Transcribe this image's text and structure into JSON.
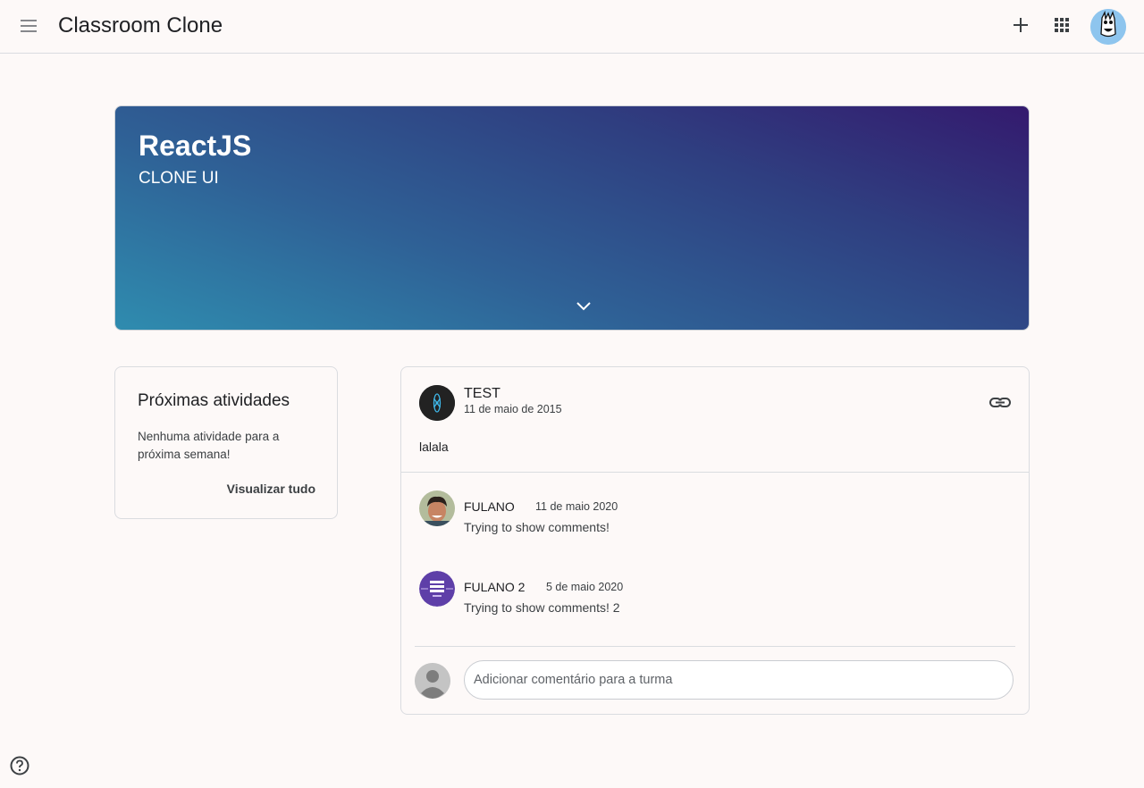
{
  "header": {
    "title": "Classroom Clone",
    "icons": [
      "menu-icon",
      "add-icon",
      "apps-icon",
      "user-avatar"
    ]
  },
  "banner": {
    "name": "ReactJS",
    "section": "CLONE UI",
    "colors": [
      "#2f8caf",
      "#2f6196",
      "#341a6e"
    ],
    "expand_icon": "chevron-down-icon"
  },
  "upcoming": {
    "title": "Próximas atividades",
    "empty_text": "Nenhuma atividade para a próxima semana!",
    "view_all": "Visualizar tudo"
  },
  "post": {
    "author": "TEST",
    "date": "11 de maio de 2015",
    "body": "lalala",
    "link_icon": "link-icon",
    "comments": [
      {
        "author": "FULANO",
        "date": "11 de maio 2020",
        "text": "Trying to show comments!"
      },
      {
        "author": "FULANO 2",
        "date": "5 de maio 2020",
        "text": "Trying to show comments! 2"
      }
    ],
    "compose_placeholder": "Adicionar comentário para a turma"
  },
  "footer": {
    "help_icon": "help-icon"
  }
}
